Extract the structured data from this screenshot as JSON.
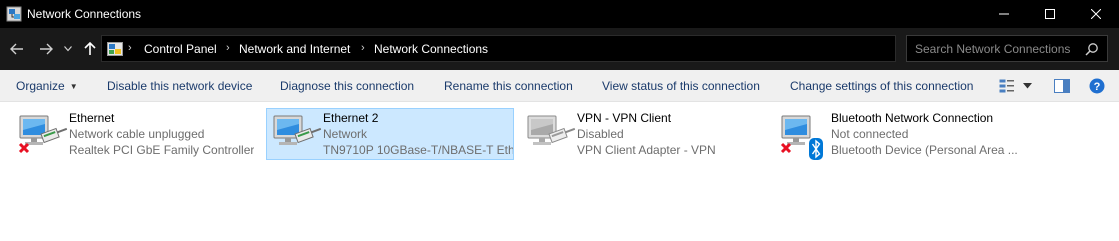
{
  "window": {
    "title": "Network Connections"
  },
  "address": {
    "crumbs": [
      "Control Panel",
      "Network and Internet",
      "Network Connections"
    ],
    "search_placeholder": "Search Network Connections"
  },
  "toolbar": {
    "organize": "Organize",
    "disable": "Disable this network device",
    "diagnose": "Diagnose this connection",
    "rename": "Rename this connection",
    "view_status": "View status of this connection",
    "change_settings": "Change settings of this connection"
  },
  "connections": [
    {
      "name": "Ethernet",
      "status": "Network cable unplugged",
      "device": "Realtek PCI GbE Family Controller",
      "state": "disconnected",
      "selected": false
    },
    {
      "name": "Ethernet 2",
      "status": "Network",
      "device": "TN9710P 10GBase-T/NBASE-T Eth...",
      "state": "connected",
      "selected": true
    },
    {
      "name": "VPN - VPN Client",
      "status": "Disabled",
      "device": "VPN Client Adapter - VPN",
      "state": "disabled",
      "selected": false
    },
    {
      "name": "Bluetooth Network Connection",
      "status": "Not connected",
      "device": "Bluetooth Device (Personal Area ...",
      "state": "disconnected-bluetooth",
      "selected": false
    }
  ],
  "icons": {
    "back": "back-arrow-icon",
    "forward": "forward-arrow-icon",
    "recent": "chevron-down-icon",
    "up": "up-arrow-icon",
    "refresh": "refresh-icon",
    "search": "search-icon",
    "view_options": "change-view-icon",
    "preview_pane": "preview-pane-icon",
    "help": "help-icon"
  },
  "colors": {
    "titlebar": "#000000",
    "addressbar": "#191919",
    "commandbar": "#f0f0f0",
    "selection": "#cce8ff",
    "link_text": "#1a3a6b",
    "error_red": "#e81123",
    "bluetooth_blue": "#0078d7"
  }
}
